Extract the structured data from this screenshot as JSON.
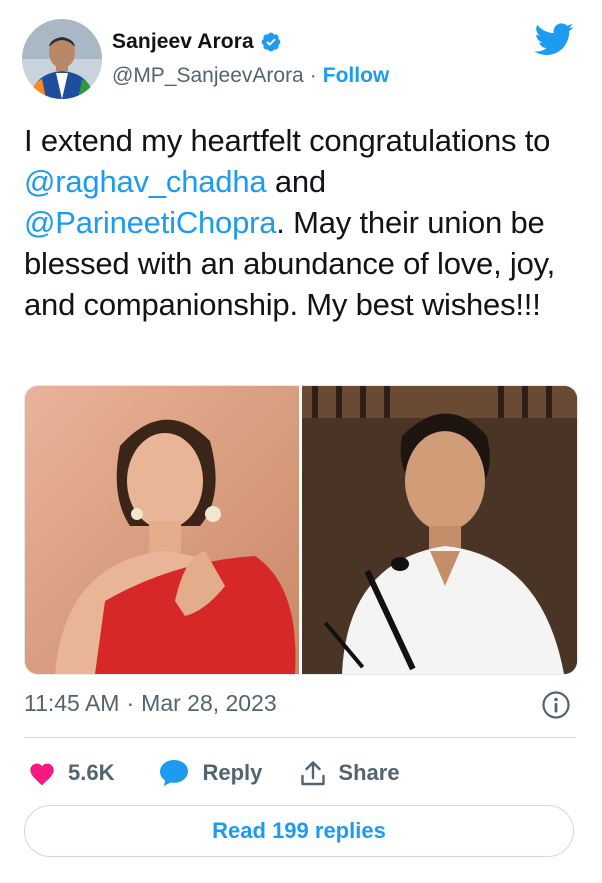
{
  "author": {
    "display_name": "Sanjeev Arora",
    "handle": "@MP_SanjeevArora",
    "separator": "·",
    "follow_label": "Follow",
    "verified": true
  },
  "tweet": {
    "text_part1": "I extend my heartfelt congratulations to ",
    "mention1": "@raghav_chadha",
    "text_part2": " and ",
    "mention2": "@ParineetiChopra",
    "text_part3": ". May their union be blessed with an abundance of love, joy, and companionship. My best wishes!!!"
  },
  "media": {
    "images": [
      "portrait-woman-red-dress",
      "man-speaking-at-microphone"
    ]
  },
  "meta": {
    "time": "11:45 AM",
    "separator": "·",
    "date": "Mar 28, 2023"
  },
  "actions": {
    "like_count": "5.6K",
    "reply_label": "Reply",
    "share_label": "Share",
    "read_replies_label": "Read 199 replies"
  },
  "icons": {
    "brand": "twitter-bird-icon",
    "verified": "verified-badge-icon",
    "info": "info-icon",
    "like": "heart-icon",
    "reply": "speech-bubble-icon",
    "share": "share-upload-icon"
  },
  "colors": {
    "accent": "#1d9bf0",
    "like": "#f91880",
    "text": "#0f1419",
    "secondary": "#536471"
  }
}
